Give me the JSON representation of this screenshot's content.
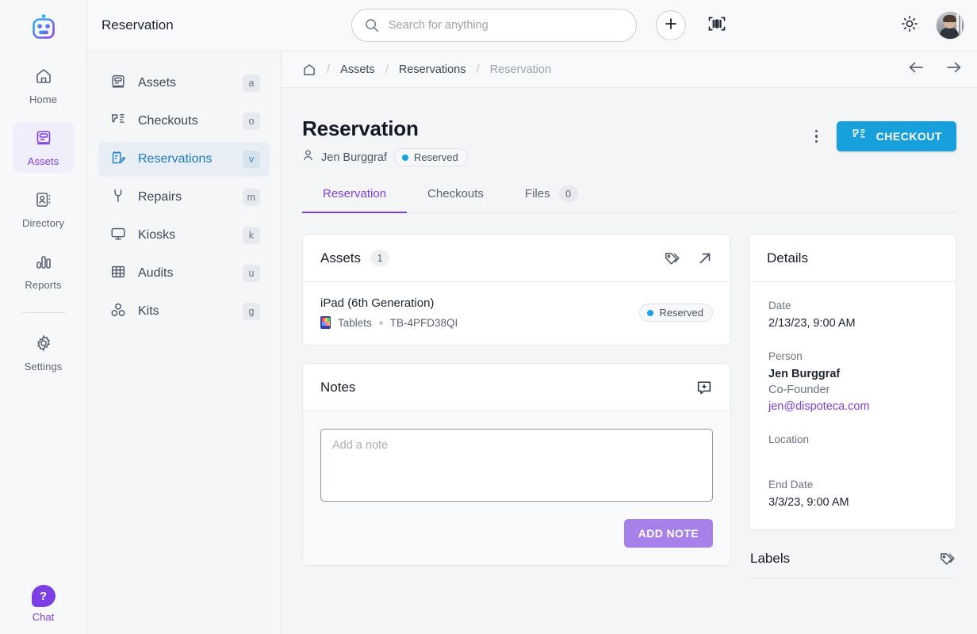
{
  "brand": {
    "logo_icon": "robot-logo-icon",
    "accent": "#7b3fe4",
    "blue": "#18a0dc"
  },
  "rail": {
    "items": [
      {
        "label": "Home",
        "icon": "home-icon",
        "active": false
      },
      {
        "label": "Assets",
        "icon": "monitor-asset-icon",
        "active": true
      },
      {
        "label": "Directory",
        "icon": "id-card-icon",
        "active": false
      },
      {
        "label": "Reports",
        "icon": "bar-chart-icon",
        "active": false
      },
      {
        "label": "Settings",
        "icon": "gear-icon",
        "active": false
      }
    ],
    "chat": {
      "label": "Chat",
      "icon": "chat-question-icon"
    }
  },
  "topbar": {
    "app_title": "Reservation",
    "search_placeholder": "Search for anything",
    "search_value": "",
    "search_icon": "search-icon",
    "add_icon": "plus-icon",
    "scan_icon": "barcode-scan-icon",
    "theme_icon": "sun-icon",
    "avatar_icon": "user-avatar"
  },
  "subnav": {
    "items": [
      {
        "label": "Assets",
        "shortcut": "a",
        "icon": "monitor-asset-icon",
        "active": false
      },
      {
        "label": "Checkouts",
        "shortcut": "o",
        "icon": "scanner-list-icon",
        "active": false
      },
      {
        "label": "Reservations",
        "shortcut": "v",
        "icon": "clipboard-pencil-icon",
        "active": true
      },
      {
        "label": "Repairs",
        "shortcut": "m",
        "icon": "wrench-icon",
        "active": false
      },
      {
        "label": "Kiosks",
        "shortcut": "k",
        "icon": "monitor-icon",
        "active": false
      },
      {
        "label": "Audits",
        "shortcut": "u",
        "icon": "grid-table-icon",
        "active": false
      },
      {
        "label": "Kits",
        "shortcut": "g",
        "icon": "boxes-icon",
        "active": false
      }
    ]
  },
  "breadcrumb": {
    "home_icon": "home-outline-icon",
    "separator": "/",
    "items": [
      {
        "label": "Assets",
        "muted": false
      },
      {
        "label": "Reservations",
        "muted": false
      },
      {
        "label": "Reservation",
        "muted": true
      }
    ],
    "back_icon": "arrow-left-icon",
    "forward_icon": "arrow-right-icon"
  },
  "page_header": {
    "title": "Reservation",
    "person_icon": "person-icon",
    "person": "Jen Burggraf",
    "status": "Reserved",
    "status_color": "#17a3e8",
    "kebab_icon": "kebab-menu-icon",
    "checkout_label": "CHECKOUT",
    "checkout_icon": "scanner-list-icon"
  },
  "tabs": [
    {
      "label": "Reservation",
      "active": true,
      "count": null
    },
    {
      "label": "Checkouts",
      "active": false,
      "count": null
    },
    {
      "label": "Files",
      "active": false,
      "count": "0"
    }
  ],
  "assets_card": {
    "title": "Assets",
    "count": "1",
    "tag_icon": "tags-icon",
    "expand_icon": "arrow-up-right-icon",
    "rows": [
      {
        "name": "iPad (6th Generation)",
        "category_icon": "tablet-app-icon",
        "category": "Tablets",
        "separator": "•",
        "serial": "TB-4PFD38QI",
        "status": "Reserved",
        "status_color": "#17a3e8"
      }
    ]
  },
  "notes_card": {
    "title": "Notes",
    "add_icon": "add-comment-icon",
    "placeholder": "Add a note",
    "value": "",
    "add_button": "ADD NOTE"
  },
  "details_card": {
    "title": "Details",
    "groups": [
      {
        "label": "Date",
        "value": "2/13/23, 9:00 AM"
      },
      {
        "label": "Person",
        "name": "Jen Burggraf",
        "role": "Co-Founder",
        "email": "jen@dispoteca.com"
      },
      {
        "label": "Location",
        "value": ""
      },
      {
        "label": "End Date",
        "value": "3/3/23, 9:00 AM"
      }
    ]
  },
  "labels_section": {
    "title": "Labels",
    "tag_icon": "tags-icon"
  }
}
